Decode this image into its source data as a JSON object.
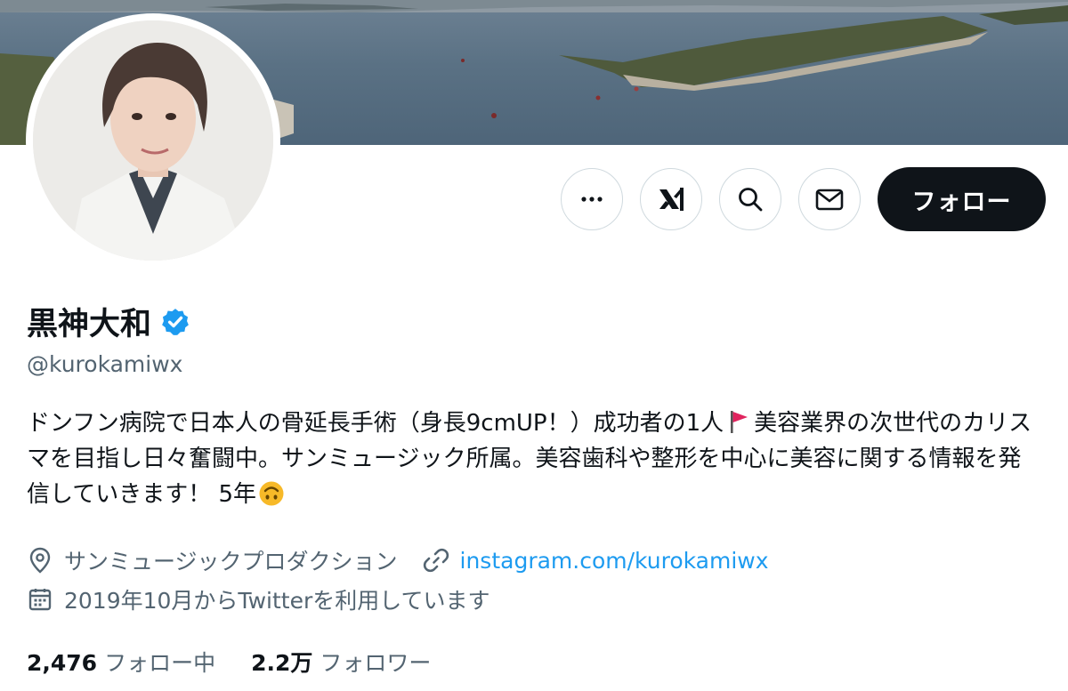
{
  "profile": {
    "name": "黒神大和",
    "handle": "@kurokamiwx",
    "bio_part1": "ドンフン病院で日本人の骨延長手術（身長9cmUP！）成功者の1人",
    "bio_part2": "美容業界の次世代のカリスマを目指し日々奮闘中。サンミュージック所属。美容歯科や整形を中心に美容に関する情報を発信していきます！ 5年",
    "location": "サンミュージックプロダクション",
    "website": "instagram.com/kurokamiwx",
    "joined": "2019年10月からTwitterを利用しています"
  },
  "stats": {
    "following_count": "2,476",
    "following_label": "フォロー中",
    "followers_count": "2.2万",
    "followers_label": "フォロワー"
  },
  "actions": {
    "follow_label": "フォロー"
  },
  "icons": [
    "more-icon",
    "grok-icon",
    "search-icon",
    "mail-icon",
    "verified-badge-icon",
    "location-icon",
    "link-icon",
    "calendar-icon",
    "red-flag-icon",
    "upside-down-face-icon"
  ],
  "colors": {
    "accent": "#1d9bf0",
    "text": "#0f1419",
    "secondary": "#536471",
    "border": "#cfd9de",
    "button": "#0f1419"
  }
}
